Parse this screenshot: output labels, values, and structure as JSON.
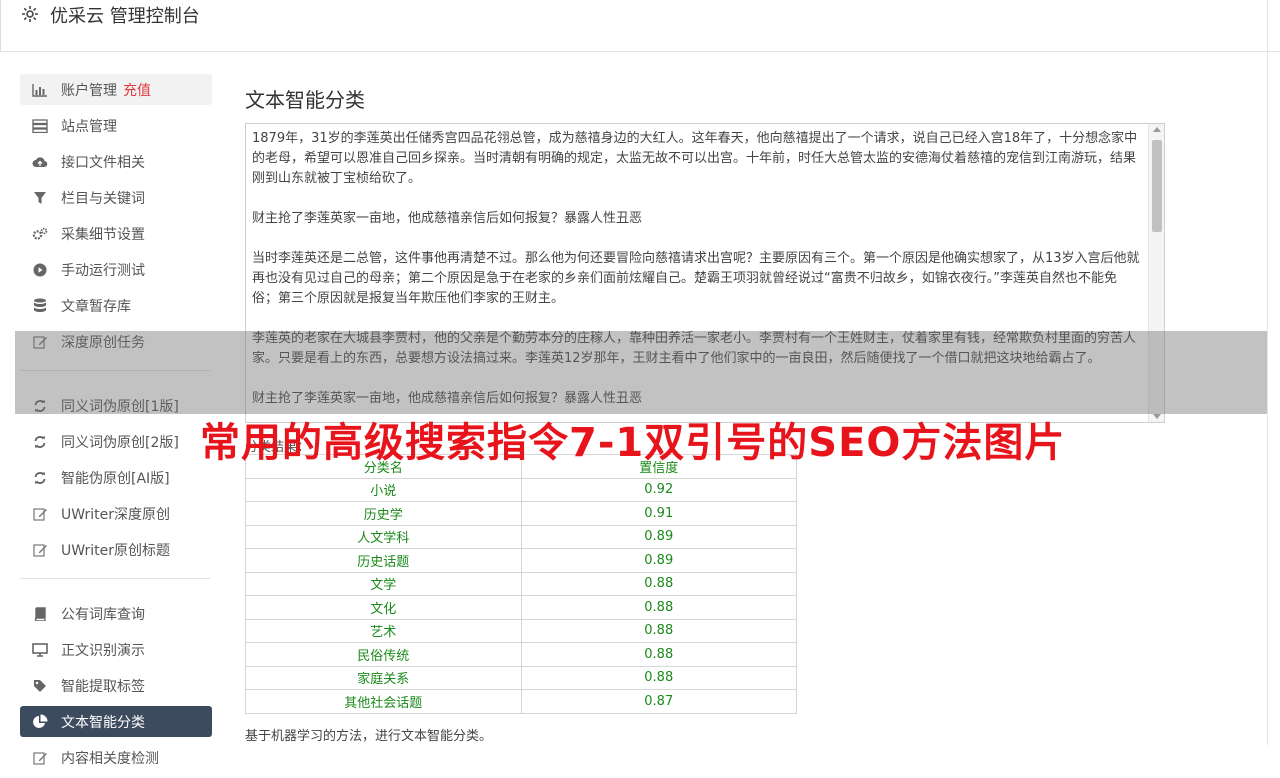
{
  "header": {
    "title": "优采云 管理控制台",
    "icon": "gear-icon"
  },
  "sidebar": {
    "group1": [
      {
        "label": "账户管理",
        "badge": "充值",
        "icon": "bar-chart-icon"
      },
      {
        "label": "站点管理",
        "icon": "server-icon"
      },
      {
        "label": "接口文件相关",
        "icon": "cloud-upload-icon"
      },
      {
        "label": "栏目与关键词",
        "icon": "filter-icon"
      },
      {
        "label": "采集细节设置",
        "icon": "gears-icon"
      },
      {
        "label": "手动运行测试",
        "icon": "play-circle-icon"
      },
      {
        "label": "文章暂存库",
        "icon": "database-icon"
      },
      {
        "label": "深度原创任务",
        "icon": "edit-icon"
      }
    ],
    "group2": [
      {
        "label": "同义词伪原创[1版]",
        "icon": "refresh-icon"
      },
      {
        "label": "同义词伪原创[2版]",
        "icon": "refresh-icon"
      },
      {
        "label": "智能伪原创[AI版]",
        "icon": "refresh-icon"
      },
      {
        "label": "UWriter深度原创",
        "icon": "edit-icon"
      },
      {
        "label": "UWriter原创标题",
        "icon": "edit-icon"
      }
    ],
    "group3": [
      {
        "label": "公有词库查询",
        "icon": "book-icon"
      },
      {
        "label": "正文识别演示",
        "icon": "monitor-icon"
      },
      {
        "label": "智能提取标签",
        "icon": "tag-icon"
      },
      {
        "label": "文本智能分类",
        "icon": "pie-chart-icon"
      },
      {
        "label": "内容相关度检测",
        "icon": "edit-icon"
      }
    ]
  },
  "main": {
    "title": "文本智能分类",
    "text_paragraphs": [
      "1879年，31岁的李莲英出任储秀宫四品花翎总管，成为慈禧身边的大红人。这年春天，他向慈禧提出了一个请求，说自己已经入宫18年了，十分想念家中的老母，希望可以恩准自己回乡探亲。当时清朝有明确的规定，太监无故不可以出宫。十年前，时任大总管太监的安德海仗着慈禧的宠信到江南游玩，结果刚到山东就被丁宝桢给砍了。",
      "财主抢了李莲英家一亩地，他成慈禧亲信后如何报复？暴露人性丑恶",
      "当时李莲英还是二总管，这件事他再清楚不过。那么他为何还要冒险向慈禧请求出宫呢？主要原因有三个。第一个原因是他确实想家了，从13岁入宫后他就再也没有见过自己的母亲；第二个原因是急于在老家的乡亲们面前炫耀自己。楚霸王项羽就曾经说过“富贵不归故乡，如锦衣夜行。”李莲英自然也不能免俗；第三个原因就是报复当年欺压他们李家的王财主。",
      "李莲英的老家在大城县李贾村，他的父亲是个勤劳本分的庄稼人，靠种田养活一家老小。李贾村有一个王姓财主，仗着家里有钱，经常欺负村里面的穷苦人家。只要是看上的东西，总要想方设法搞过来。李莲英12岁那年，王财主看中了他们家中的一亩良田，然后随便找了一个借口就把这块地给霸占了。",
      "财主抢了李莲英家一亩地，他成慈禧亲信后如何报复？暴露人性丑恶"
    ],
    "result_label": "分类结果：",
    "table": {
      "headers": [
        "分类名",
        "置信度"
      ],
      "rows": [
        [
          "小说",
          "0.92"
        ],
        [
          "历史学",
          "0.91"
        ],
        [
          "人文学科",
          "0.89"
        ],
        [
          "历史话题",
          "0.89"
        ],
        [
          "文学",
          "0.88"
        ],
        [
          "文化",
          "0.88"
        ],
        [
          "艺术",
          "0.88"
        ],
        [
          "民俗传统",
          "0.88"
        ],
        [
          "家庭关系",
          "0.88"
        ],
        [
          "其他社会话题",
          "0.87"
        ]
      ]
    },
    "footer_note": "基于机器学习的方法，进行文本智能分类。"
  },
  "watermark": "常用的高级搜索指令7-1双引号的SEO方法图片"
}
